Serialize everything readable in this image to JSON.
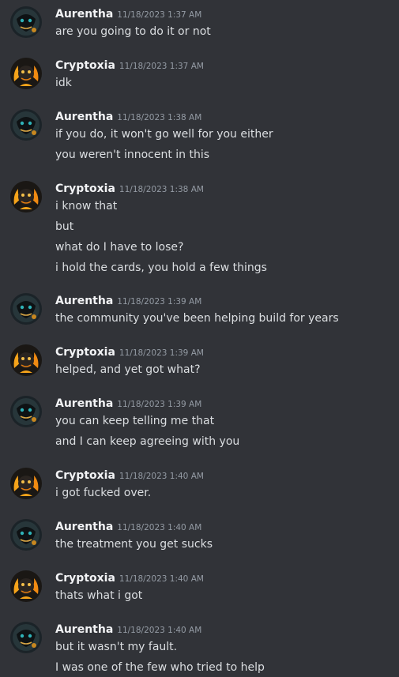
{
  "users": {
    "aurentha": {
      "name": "Aurentha",
      "avatar_icon": "dark-creature-avatar-icon",
      "accent": "#1f6f73"
    },
    "cryptoxia": {
      "name": "Cryptoxia",
      "avatar_icon": "flame-creature-avatar-icon",
      "accent": "#f5a31a"
    }
  },
  "messages": [
    {
      "author": "Aurentha",
      "time": "11/18/2023 1:37 AM",
      "lines": [
        "are you going to do it or not"
      ]
    },
    {
      "author": "Cryptoxia",
      "time": "11/18/2023 1:37 AM",
      "lines": [
        "idk"
      ]
    },
    {
      "author": "Aurentha",
      "time": "11/18/2023 1:38 AM",
      "lines": [
        "if you do, it won't go well for you either",
        "you weren't innocent in this"
      ]
    },
    {
      "author": "Cryptoxia",
      "time": "11/18/2023 1:38 AM",
      "lines": [
        "i know that",
        "but",
        "what do I have to lose?",
        "i hold the cards, you hold a few things"
      ]
    },
    {
      "author": "Aurentha",
      "time": "11/18/2023 1:39 AM",
      "lines": [
        "the community you've been helping build for years"
      ]
    },
    {
      "author": "Cryptoxia",
      "time": "11/18/2023 1:39 AM",
      "lines": [
        "helped, and yet got what?"
      ]
    },
    {
      "author": "Aurentha",
      "time": "11/18/2023 1:39 AM",
      "lines": [
        "you can keep telling me that",
        "and I can keep agreeing with you"
      ]
    },
    {
      "author": "Cryptoxia",
      "time": "11/18/2023 1:40 AM",
      "lines": [
        "i got fucked over."
      ]
    },
    {
      "author": "Aurentha",
      "time": "11/18/2023 1:40 AM",
      "lines": [
        "the treatment you get sucks"
      ]
    },
    {
      "author": "Cryptoxia",
      "time": "11/18/2023 1:40 AM",
      "lines": [
        "thats what i got"
      ]
    },
    {
      "author": "Aurentha",
      "time": "11/18/2023 1:40 AM",
      "lines": [
        "but it wasn't my fault.",
        "I was one of the few who tried to help"
      ]
    }
  ]
}
